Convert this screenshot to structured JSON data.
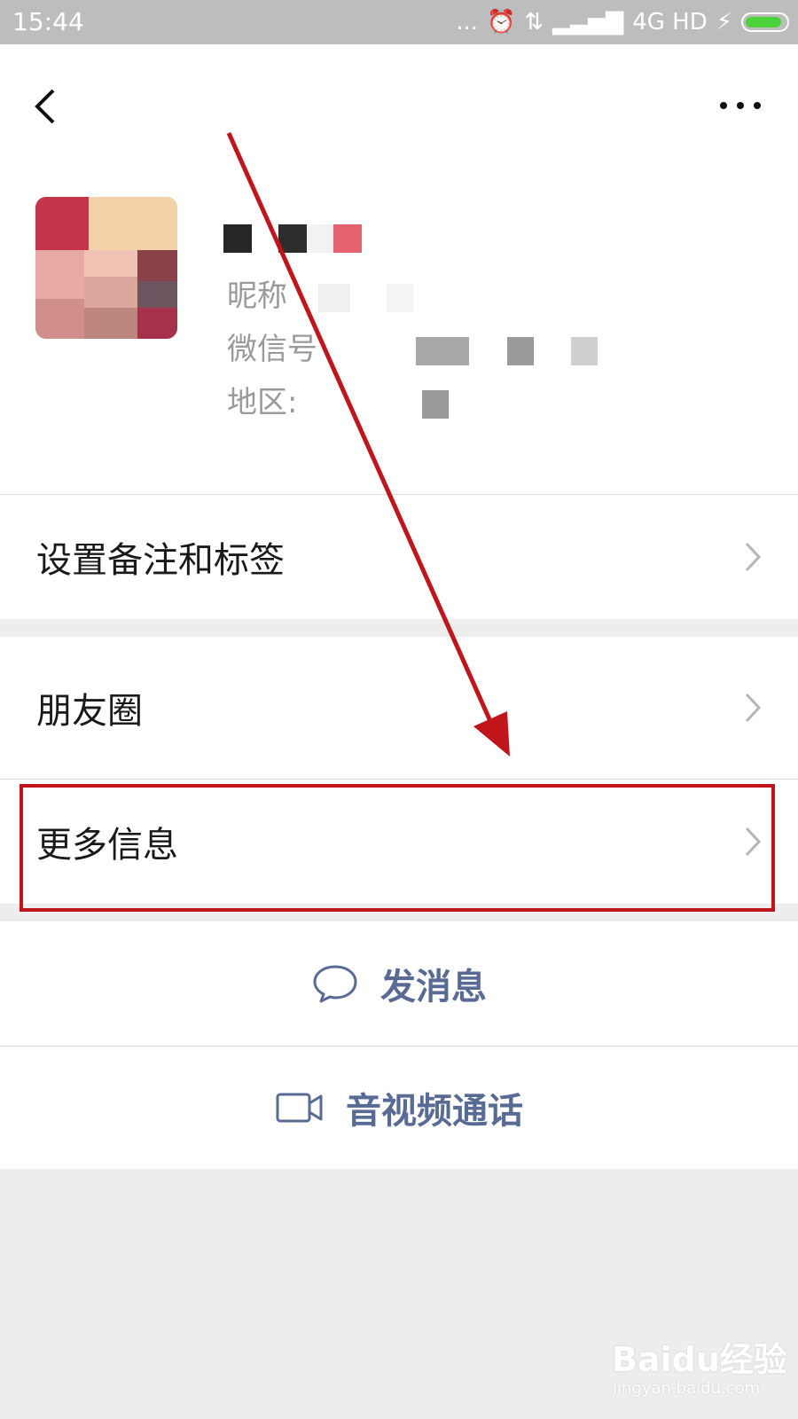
{
  "status_bar": {
    "time": "15:44",
    "network": "4G HD",
    "dots": "..."
  },
  "profile": {
    "nickname_label": "昵称",
    "wechat_id_label": "微信号",
    "region_label": "地区:"
  },
  "rows": {
    "remark_tags": "设置备注和标签",
    "moments": "朋友圈",
    "more_info": "更多信息"
  },
  "actions": {
    "send_message": "发消息",
    "av_call": "音视频通话"
  },
  "watermark": {
    "brand": "Baidu经验",
    "url": "jingyan.baidu.com"
  },
  "colors": {
    "link": "#576b95",
    "highlight": "#c0151a",
    "battery": "#4cd23b"
  }
}
